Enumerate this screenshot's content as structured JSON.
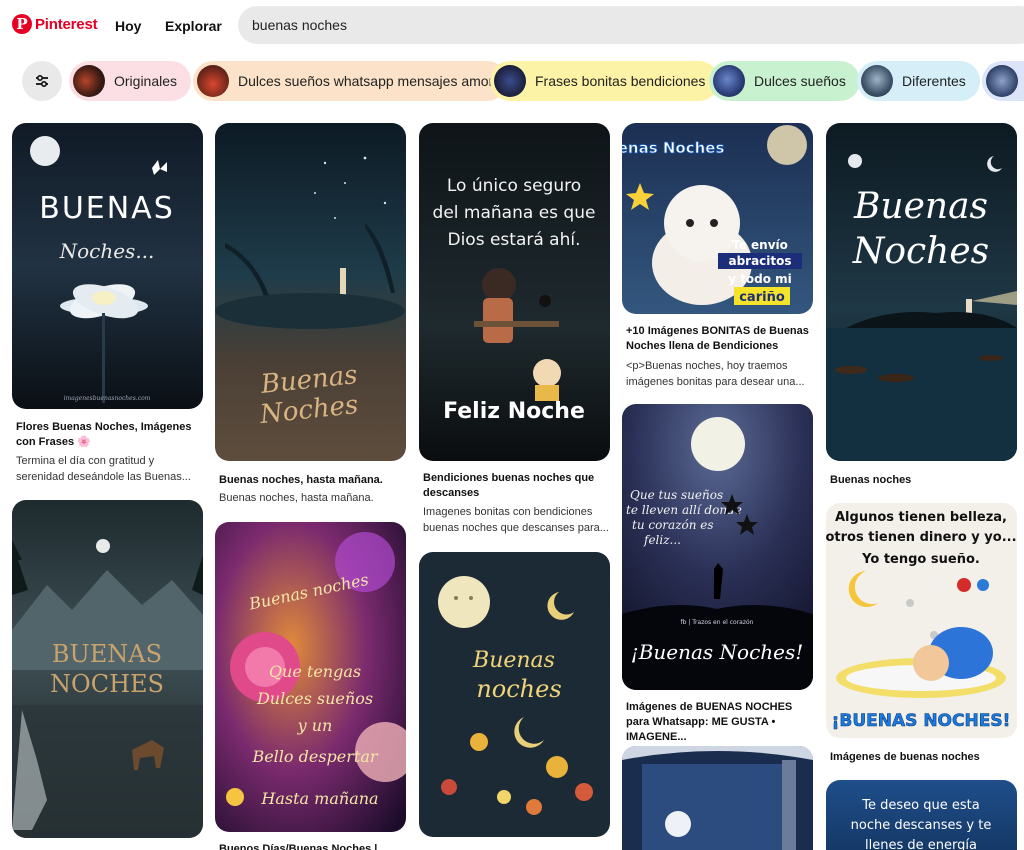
{
  "header": {
    "logo_text": "Pinterest",
    "nav_hoy": "Hoy",
    "nav_explorar": "Explorar",
    "search_value": "buenas noches"
  },
  "chips": [
    {
      "label": "Originales",
      "color": "#fbdfe4"
    },
    {
      "label": "Dulces sueños whatsapp mensajes amor",
      "color": "#fbe2c8"
    },
    {
      "label": "Frases bonitas bendiciones",
      "color": "#fcf3a7"
    },
    {
      "label": "Dulces sueños",
      "color": "#c8f1cf"
    },
    {
      "label": "Diferentes",
      "color": "#d5eef7"
    }
  ],
  "pins": {
    "p1": {
      "img_title": "BUENAS",
      "img_sub": "Noches...",
      "watermark": "imagenesbuenasnoches.com",
      "title": "Flores Buenas Noches, Imágenes con Frases 🌸",
      "desc": "Termina el día con gratitud y serenidad deseándole las Buenas..."
    },
    "p2": {
      "img_title": "BUENAS",
      "img_sub": "NOCHES"
    },
    "p3": {
      "img_title": "Buenas",
      "img_sub": "Noches",
      "title": "Buenas noches, hasta mañana.",
      "desc": "Buenas noches, hasta mañana."
    },
    "p4": {
      "img_line1": "Buenas noches",
      "img_line2": "Que tengas",
      "img_line3": "Dulces sueños",
      "img_line4": "y un",
      "img_line5": "Bello despertar",
      "img_line6": "Hasta mañana",
      "title": "Buenos Días/Buenas Noches |"
    },
    "p5": {
      "img_line1": "Lo único seguro",
      "img_line2": "del mañana es que",
      "img_line3": "Dios estará ahí.",
      "img_bottom": "Feliz Noche",
      "title": "Bendiciones buenas noches que descanses",
      "desc": "Imagenes bonitas con bendiciones buenas noches que descanses para..."
    },
    "p6": {
      "img_title": "Buenas",
      "img_sub": "noches"
    },
    "p7": {
      "img_title": "Buenas Noches",
      "img_line1": "Te envío",
      "img_line2": "abracitos",
      "img_line3": "y todo mi",
      "img_line4": "cariño",
      "title": "+10 Imágenes BONITAS de Buenas Noches llena de Bendiciones",
      "desc": "<p>Buenas noches, hoy traemos imágenes bonitas para desear una..."
    },
    "p8": {
      "img_line1": "Que tus sueños",
      "img_line2": "te lleven allí donde",
      "img_line3": "tu corazón es",
      "img_line4": "feliz...",
      "img_credit": "fb | Trazos en el corazón",
      "img_bottom": "¡Buenas Noches!",
      "title": "Imágenes de BUENAS NOCHES para Whatsapp: ME GUSTA • IMAGENE..."
    },
    "p10": {
      "img_title": "Buenas",
      "img_sub": "Noches",
      "title": "Buenas noches"
    },
    "p11": {
      "img_line1": "Algunos tienen belleza,",
      "img_line2": "otros tienen dinero y yo...",
      "img_line3": "Yo tengo sueño.",
      "img_bottom": "¡BUENAS NOCHES!",
      "title": "Imágenes de buenas noches"
    },
    "p12": {
      "img_line1": "Te deseo que esta",
      "img_line2": "noche descanses y te",
      "img_line3": "llenes de energía"
    }
  }
}
